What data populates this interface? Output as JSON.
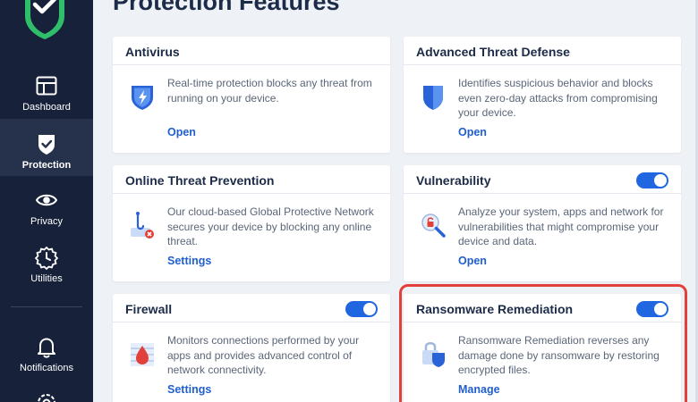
{
  "sidebar": {
    "items": [
      {
        "label": "Dashboard",
        "icon": "dashboard-icon"
      },
      {
        "label": "Protection",
        "icon": "shield-check-icon",
        "active": true
      },
      {
        "label": "Privacy",
        "icon": "eye-icon"
      },
      {
        "label": "Utilities",
        "icon": "utilities-icon"
      },
      {
        "label": "Notifications",
        "icon": "bell-icon"
      }
    ]
  },
  "page": {
    "title": "Protection Features"
  },
  "cards": {
    "antivirus": {
      "title": "Antivirus",
      "description": "Real-time protection blocks any threat from running on your device.",
      "link": "Open"
    },
    "atd": {
      "title": "Advanced Threat Defense",
      "description": "Identifies suspicious behavior and blocks even zero-day attacks from compromising your device.",
      "link": "Open"
    },
    "otp": {
      "title": "Online Threat Prevention",
      "description": "Our cloud-based Global Protective Network secures your device by blocking any online threat.",
      "link": "Settings"
    },
    "vulnerability": {
      "title": "Vulnerability",
      "description": "Analyze your system, apps and network for vulnerabilities that might compromise your device and data.",
      "link": "Open",
      "toggle": true
    },
    "firewall": {
      "title": "Firewall",
      "description": "Monitors connections performed by your apps and provides advanced control of network connectivity.",
      "link": "Settings",
      "toggle": true
    },
    "ransomware": {
      "title": "Ransomware Remediation",
      "description": "Ransomware Remediation reverses any damage done by ransomware by restoring encrypted files.",
      "link": "Manage",
      "toggle": true
    }
  },
  "colors": {
    "sidebar_bg": "#17223a",
    "accent": "#1f66e0",
    "highlight": "#e2403a",
    "logo_green": "#2fbf6a"
  }
}
